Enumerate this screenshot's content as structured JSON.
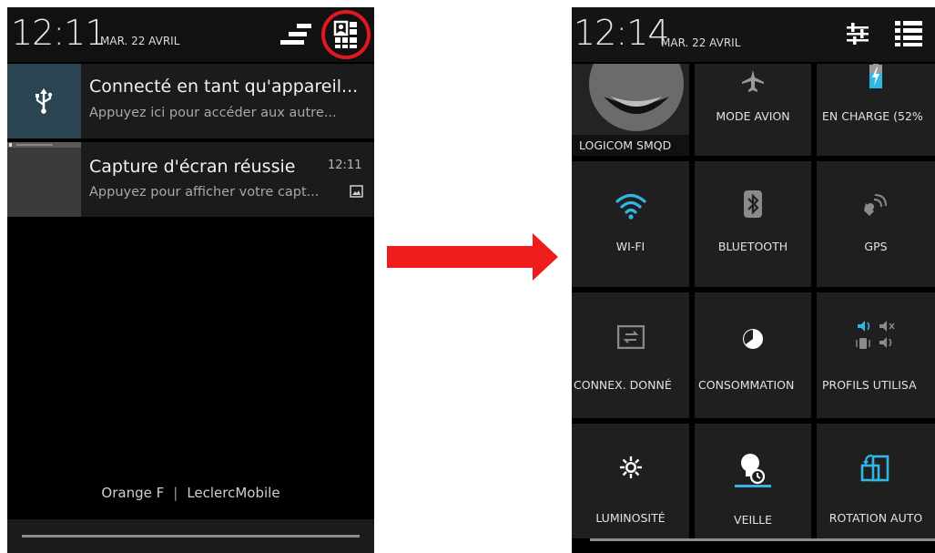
{
  "left_screen": {
    "status_bar": {
      "time": "12:11",
      "date": "MAR. 22 AVRIL",
      "icons": [
        "clear-notifications-icon",
        "quick-settings-icon"
      ],
      "highlight_color": "#e0191f"
    },
    "notifications": [
      {
        "icon": "usb-icon",
        "title": "Connecté en tant qu'appareil...",
        "subtitle": "Appuyez ici pour accéder aux autre..."
      },
      {
        "icon": "screenshot-thumbnail",
        "title": "Capture d'écran réussie",
        "subtitle": "Appuyez pour afficher votre capt...",
        "time": "12:11"
      }
    ],
    "carriers": [
      "Orange F",
      "LeclercMobile"
    ],
    "carrier_separator": "|"
  },
  "arrow": {
    "color": "#ee1c1c"
  },
  "right_screen": {
    "status_bar": {
      "time": "12:14",
      "date": "MAR. 22 AVRIL",
      "icons": [
        "settings-sliders-icon",
        "notifications-list-icon"
      ]
    },
    "tiles": [
      {
        "id": "profile",
        "label": "LOGICOM SMQD",
        "icon": "avatar-icon"
      },
      {
        "id": "airplane",
        "label": "MODE AVION",
        "icon": "airplane-icon"
      },
      {
        "id": "battery",
        "label": "EN CHARGE (52%",
        "icon": "battery-charging-icon"
      },
      {
        "id": "wifi",
        "label": "WI-FI",
        "icon": "wifi-icon",
        "accent": "#33b5e5"
      },
      {
        "id": "bluetooth",
        "label": "BLUETOOTH",
        "icon": "bluetooth-icon"
      },
      {
        "id": "gps",
        "label": "GPS",
        "icon": "gps-icon"
      },
      {
        "id": "data",
        "label": "CONNEX. DONNÉ",
        "icon": "data-connection-icon"
      },
      {
        "id": "usage",
        "label": "CONSOMMATION",
        "icon": "usage-icon"
      },
      {
        "id": "profiles",
        "label": "PROFILS UTILISA",
        "icon": "audio-profiles-icon"
      },
      {
        "id": "brightness",
        "label": "LUMINOSITÉ",
        "icon": "brightness-icon"
      },
      {
        "id": "sleep",
        "label": "VEILLE",
        "icon": "sleep-timer-icon"
      },
      {
        "id": "rotation",
        "label": "ROTATION AUTO",
        "icon": "auto-rotate-icon",
        "accent": "#33b5e5"
      }
    ]
  }
}
